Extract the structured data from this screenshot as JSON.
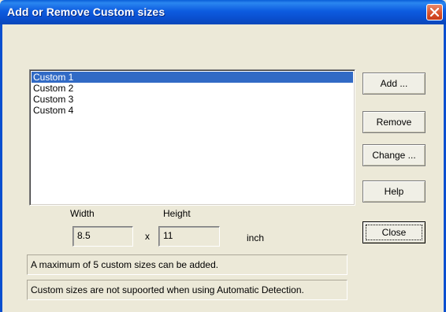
{
  "window": {
    "title": "Add or Remove Custom sizes",
    "close_icon": "close-x-icon",
    "close_color": "#d9532c"
  },
  "list": {
    "items": [
      "Custom 1",
      "Custom 2",
      "Custom 3",
      "Custom 4"
    ],
    "selected_index": 0
  },
  "buttons": {
    "add": "Add ...",
    "remove": "Remove",
    "change": "Change ...",
    "help": "Help",
    "close": "Close"
  },
  "size": {
    "width_label": "Width",
    "height_label": "Height",
    "width_value": "8.5",
    "height_value": "11",
    "separator": "x",
    "unit": "inch"
  },
  "messages": {
    "max_sizes": "A maximum of 5 custom sizes can be added.",
    "unsupported": "Custom sizes are not supoorted when using Automatic Detection."
  },
  "colors": {
    "title_bar": "#0a4fcf",
    "selection": "#316ac5",
    "dialog_bg": "#ece9d8"
  }
}
